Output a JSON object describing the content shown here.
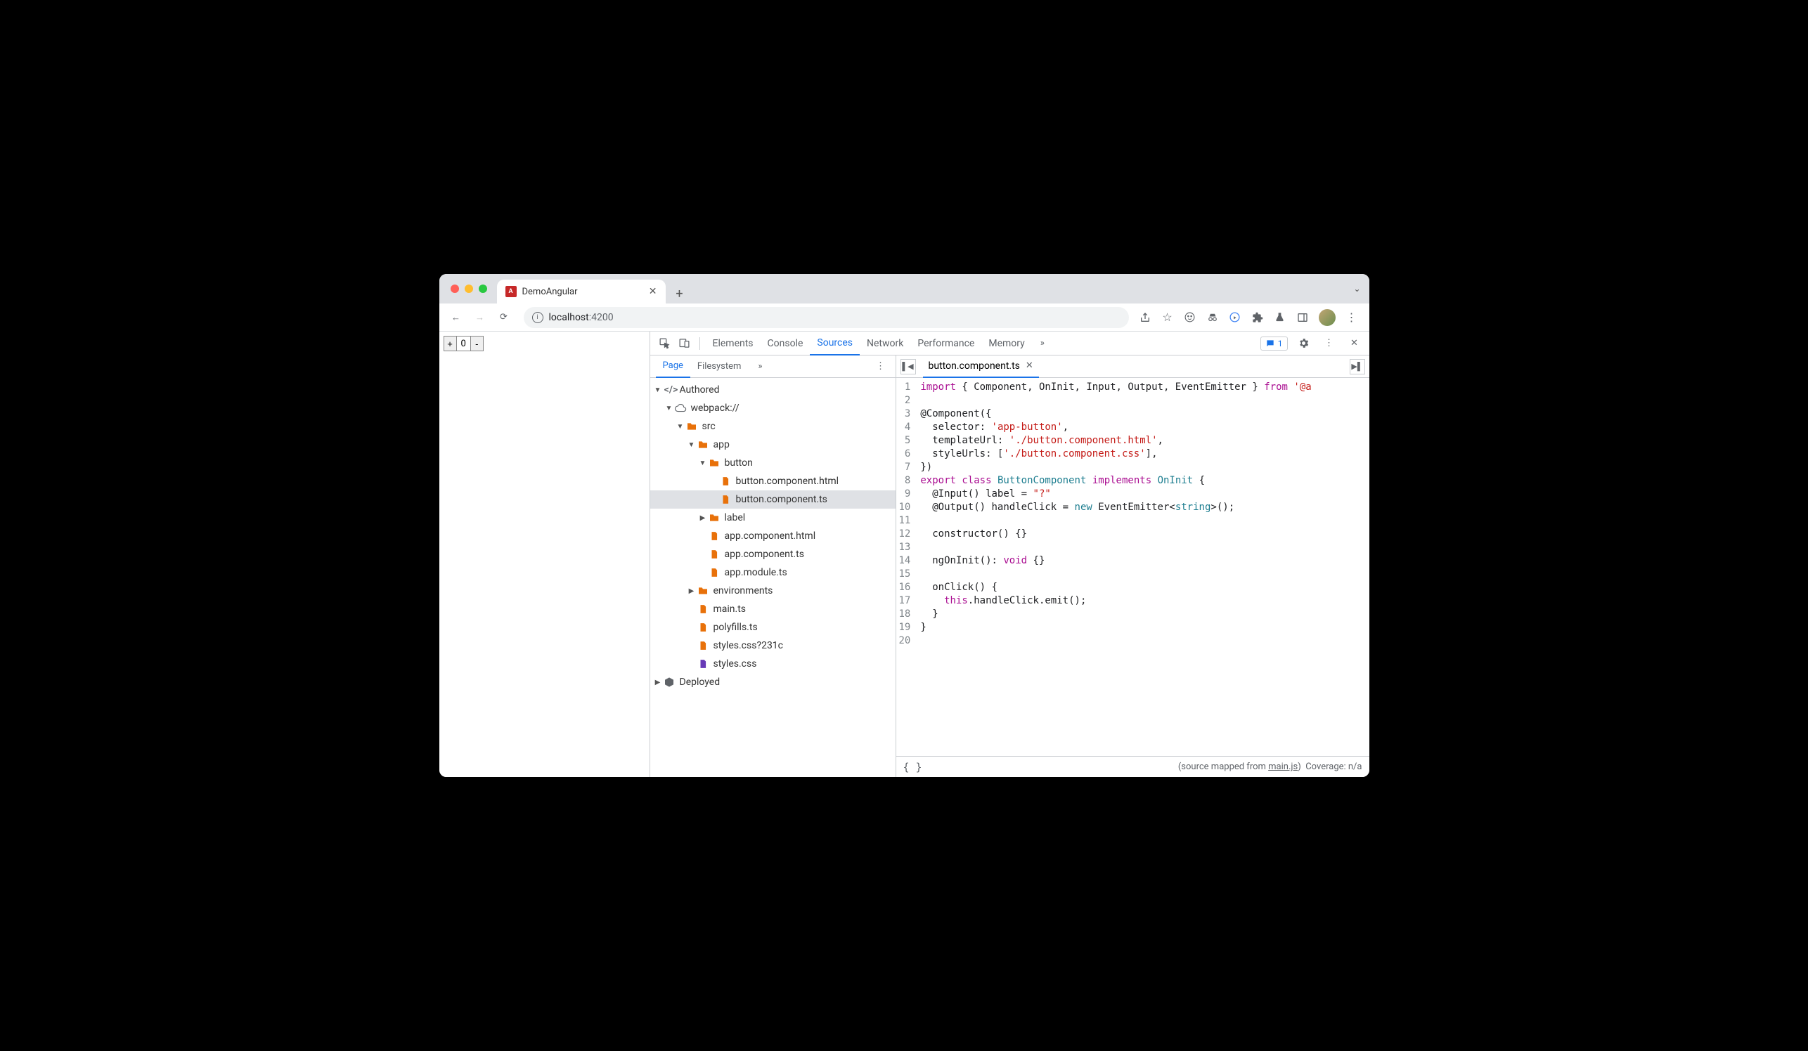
{
  "browser": {
    "tab_title": "DemoAngular",
    "url_host": "localhost",
    "url_port": ":4200"
  },
  "page": {
    "counter_minus": "-",
    "counter_value": "0",
    "counter_plus": "+"
  },
  "devtools": {
    "tabs": [
      "Elements",
      "Console",
      "Sources",
      "Network",
      "Performance",
      "Memory"
    ],
    "active_tab": "Sources",
    "issues_count": "1",
    "sources": {
      "subtabs": [
        "Page",
        "Filesystem"
      ],
      "active_subtab": "Page",
      "tree": {
        "authored": "Authored",
        "webpack": "webpack://",
        "src": "src",
        "app": "app",
        "button": "button",
        "button_html": "button.component.html",
        "button_ts": "button.component.ts",
        "label": "label",
        "app_html": "app.component.html",
        "app_ts": "app.component.ts",
        "app_module": "app.module.ts",
        "environments": "environments",
        "main_ts": "main.ts",
        "polyfills": "polyfills.ts",
        "styles_q": "styles.css?231c",
        "styles": "styles.css",
        "deployed": "Deployed"
      }
    },
    "editor": {
      "open_file": "button.component.ts",
      "lines": [
        [
          [
            "import",
            "kw"
          ],
          [
            " { Component, OnInit, Input, Output, EventEmitter } ",
            ""
          ],
          [
            "from",
            "kw"
          ],
          [
            " ",
            ""
          ],
          [
            "'@a",
            "str"
          ]
        ],
        [],
        [
          [
            "@Component({",
            ""
          ]
        ],
        [
          [
            "  selector: ",
            ""
          ],
          [
            "'app-button'",
            "str"
          ],
          [
            ",",
            ""
          ]
        ],
        [
          [
            "  templateUrl: ",
            ""
          ],
          [
            "'./button.component.html'",
            "str"
          ],
          [
            ",",
            ""
          ]
        ],
        [
          [
            "  styleUrls: [",
            ""
          ],
          [
            "'./button.component.css'",
            "str"
          ],
          [
            "],",
            ""
          ]
        ],
        [
          [
            "})",
            ""
          ]
        ],
        [
          [
            "export",
            "kw"
          ],
          [
            " ",
            ""
          ],
          [
            "class",
            "kw"
          ],
          [
            " ",
            ""
          ],
          [
            "ButtonComponent",
            "cls"
          ],
          [
            " ",
            ""
          ],
          [
            "implements",
            "kw"
          ],
          [
            " ",
            ""
          ],
          [
            "OnInit",
            "cls"
          ],
          [
            " {",
            ""
          ]
        ],
        [
          [
            "  @Input() label = ",
            ""
          ],
          [
            "\"?\"",
            "str"
          ]
        ],
        [
          [
            "  @Output() handleClick = ",
            ""
          ],
          [
            "new",
            "new"
          ],
          [
            " EventEmitter<",
            ""
          ],
          [
            "string",
            "type"
          ],
          [
            ">();",
            ""
          ]
        ],
        [],
        [
          [
            "  constructor() {}",
            ""
          ]
        ],
        [],
        [
          [
            "  ngOnInit(): ",
            ""
          ],
          [
            "void",
            "void"
          ],
          [
            " {}",
            ""
          ]
        ],
        [],
        [
          [
            "  onClick() {",
            ""
          ]
        ],
        [
          [
            "    ",
            ""
          ],
          [
            "this",
            "kw"
          ],
          [
            ".handleClick.emit();",
            ""
          ]
        ],
        [
          [
            "  }",
            ""
          ]
        ],
        [
          [
            "}",
            ""
          ]
        ],
        []
      ]
    },
    "status": {
      "source_map_prefix": "(source mapped from ",
      "source_map_link": "main.js",
      "source_map_suffix": ")",
      "coverage": "Coverage: n/a"
    }
  }
}
